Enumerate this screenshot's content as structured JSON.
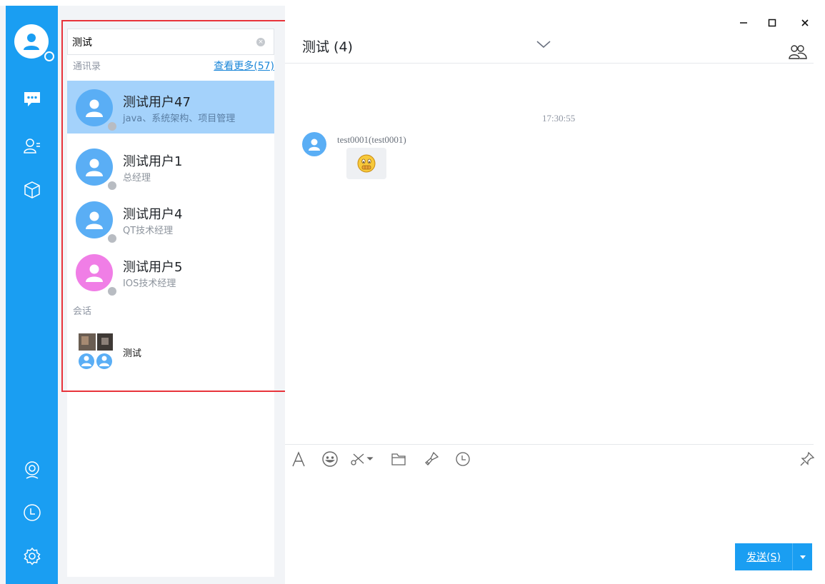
{
  "search": {
    "query": "测试",
    "contacts_label": "通讯录",
    "see_more": "查看更多(57)",
    "sessions_label": "会话"
  },
  "contacts": [
    {
      "name": "测试用户47",
      "desc": "java、系统架构、项目管理",
      "avatar_color": "#5aaef5",
      "selected": true
    },
    {
      "name": "测试用户1",
      "desc": "总经理",
      "avatar_color": "#5aaef5",
      "selected": false
    },
    {
      "name": "测试用户4",
      "desc": "QT技术经理",
      "avatar_color": "#5aaef5",
      "selected": false
    },
    {
      "name": "测试用户5",
      "desc": "IOS技术经理",
      "avatar_color": "#f07ee6",
      "selected": false
    }
  ],
  "sessions": [
    {
      "name": "测试"
    }
  ],
  "chat": {
    "title": "测试 (4)",
    "messages": [
      {
        "time": "17:30:55",
        "sender": "test0001(test0001)",
        "content": "emoji-shush"
      }
    ]
  },
  "composer": {
    "send_label": "发送(S)"
  },
  "rail": {
    "icons": [
      "avatar-icon",
      "chat-icon",
      "contacts-icon",
      "apps-icon",
      "webcam-icon",
      "history-icon",
      "settings-icon"
    ]
  },
  "colors": {
    "accent": "#1a9ef2",
    "selected_row": "#a4d2fb",
    "highlight_border": "#e8333a"
  }
}
